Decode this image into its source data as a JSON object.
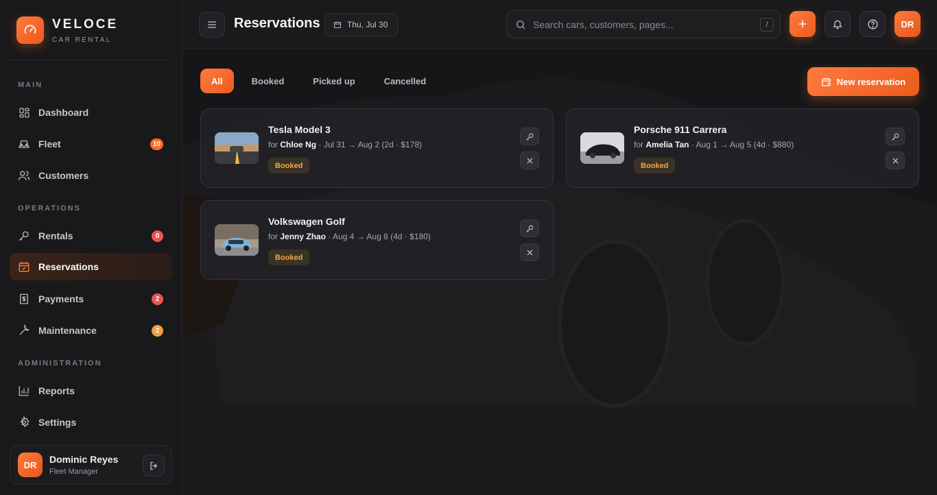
{
  "brand": {
    "name": "VELOCE",
    "subtitle": "CAR RENTAL"
  },
  "sidebar": {
    "sections": {
      "main": "MAIN",
      "operations": "OPERATIONS",
      "administration": "ADMINISTRATION"
    },
    "items": [
      {
        "label": "Dashboard",
        "icon": "dashboard-icon"
      },
      {
        "label": "Fleet",
        "icon": "car-icon",
        "badge": "10",
        "badge_color": "#ff6a2b"
      },
      {
        "label": "Customers",
        "icon": "users-icon"
      },
      {
        "label": "Rentals",
        "icon": "key-icon",
        "badge": "0",
        "badge_color": "#ef5350"
      },
      {
        "label": "Reservations",
        "icon": "calendar-check-icon",
        "active": true
      },
      {
        "label": "Payments",
        "icon": "receipt-icon",
        "badge": "2",
        "badge_color": "#ef5350"
      },
      {
        "label": "Maintenance",
        "icon": "wrench-icon",
        "badge": "2",
        "badge_color": "#f0a040"
      },
      {
        "label": "Reports",
        "icon": "bar-chart-icon"
      },
      {
        "label": "Settings",
        "icon": "gear-icon"
      }
    ],
    "user": {
      "initials": "DR",
      "name": "Dominic Reyes",
      "role": "Fleet Manager"
    }
  },
  "header": {
    "title": "Reservations",
    "date": "Thu, Jul 30",
    "search_placeholder": "Search cars, customers, pages...",
    "search_shortcut": "/",
    "avatar_initials": "DR"
  },
  "filters": {
    "tabs": [
      "All",
      "Booked",
      "Picked up",
      "Cancelled"
    ],
    "active": "All"
  },
  "new_button": "New reservation",
  "reservations": [
    {
      "car": "Tesla Model 3",
      "for_prefix": "for",
      "customer": "Chloe Ng",
      "details": "· Jul 31 → Aug 2 (2d · $178)",
      "status": "Booked"
    },
    {
      "car": "Porsche 911 Carrera",
      "for_prefix": "for",
      "customer": "Amelia Tan",
      "details": "· Aug 1 → Aug 5 (4d · $880)",
      "status": "Booked"
    },
    {
      "car": "Volkswagen Golf",
      "for_prefix": "for",
      "customer": "Jenny Zhao",
      "details": "· Aug 4 → Aug 8 (4d · $180)",
      "status": "Booked"
    }
  ],
  "colors": {
    "accent": "#ff6a2b",
    "status_booked": "#f0a64a",
    "background": "#161618"
  }
}
